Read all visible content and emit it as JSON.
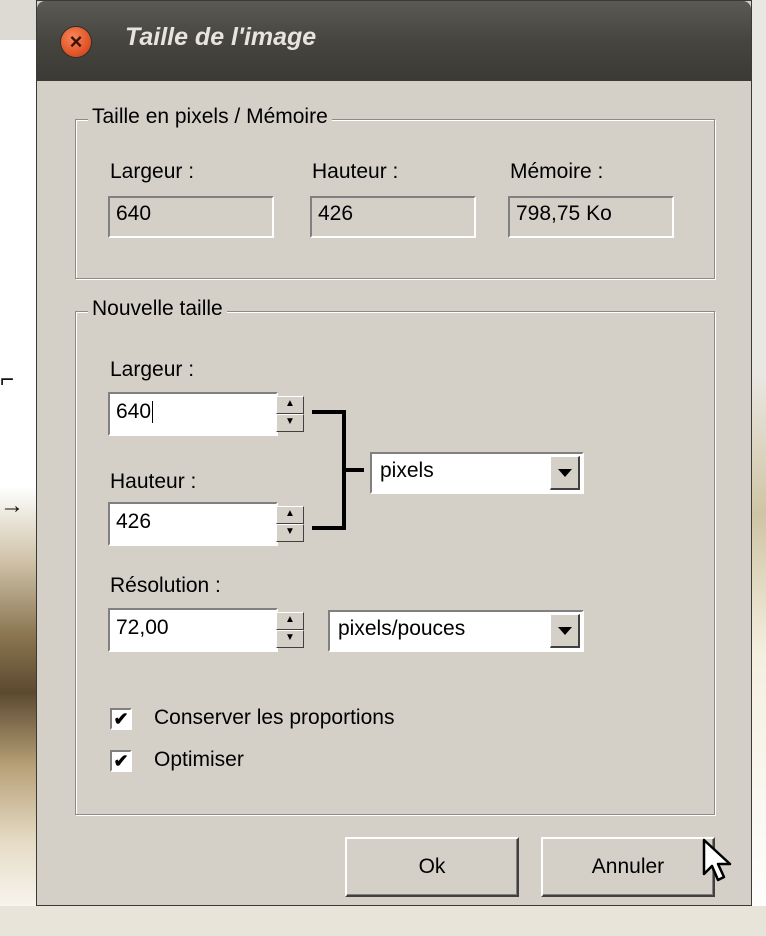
{
  "dialog": {
    "title": "Taille de l'image",
    "pixel_group": {
      "legend": "Taille en pixels / Mémoire",
      "width_label": "Largeur :",
      "width_value": "640",
      "height_label": "Hauteur :",
      "height_value": "426",
      "memory_label": "Mémoire :",
      "memory_value": "798,75 Ko"
    },
    "new_size_group": {
      "legend": "Nouvelle taille",
      "width_label": "Largeur :",
      "width_value": "640",
      "height_label": "Hauteur :",
      "height_value": "426",
      "unit_value": "pixels",
      "resolution_label": "Résolution :",
      "resolution_value": "72,00",
      "resolution_unit_value": "pixels/pouces",
      "keep_proportions_label": "Conserver les proportions",
      "keep_proportions_checked": true,
      "optimize_label": "Optimiser",
      "optimize_checked": true
    },
    "buttons": {
      "ok_label": "Ok",
      "cancel_label": "Annuler"
    }
  },
  "icons": {
    "close": "close-icon",
    "spin_up": "spin-up-icon",
    "spin_down": "spin-down-icon",
    "dropdown": "chevron-down-icon",
    "check": "checkmark-icon",
    "cursor": "mouse-pointer-icon"
  },
  "colors": {
    "dialog_bg": "#d4d0c8",
    "titlebar_bg": "#46453f",
    "close_button": "#e15628",
    "title_text": "#e6e4dc"
  }
}
